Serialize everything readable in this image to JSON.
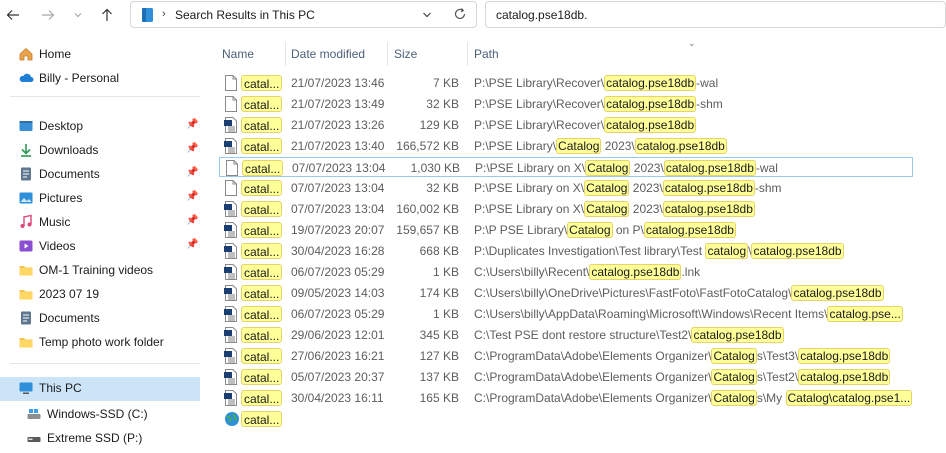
{
  "nav": {
    "back": "←",
    "forward": "→",
    "up": "↑"
  },
  "address": {
    "breadcrumb": "Search Results in This PC"
  },
  "search": {
    "value": "catalog.pse18db."
  },
  "sidebar": {
    "items": [
      {
        "label": "Home",
        "icon": "home-icon"
      },
      {
        "label": "Billy - Personal",
        "icon": "onedrive-icon"
      },
      {
        "label": "Desktop",
        "icon": "desktop-icon"
      },
      {
        "label": "Downloads",
        "icon": "downloads-icon"
      },
      {
        "label": "Documents",
        "icon": "documents-icon"
      },
      {
        "label": "Pictures",
        "icon": "pictures-icon"
      },
      {
        "label": "Music",
        "icon": "music-icon"
      },
      {
        "label": "Videos",
        "icon": "videos-icon"
      },
      {
        "label": "OM-1 Training videos",
        "icon": "folder-icon"
      },
      {
        "label": "2023 07 19",
        "icon": "folder-icon"
      },
      {
        "label": "Documents",
        "icon": "documents-icon"
      },
      {
        "label": "Temp photo work folder",
        "icon": "folder-icon"
      },
      {
        "label": "This PC",
        "icon": "this-pc-icon"
      },
      {
        "label": "Windows-SSD (C:)",
        "icon": "drive-icon"
      },
      {
        "label": "Extreme SSD (P:)",
        "icon": "drive-icon"
      }
    ]
  },
  "columns": {
    "name": "Name",
    "date": "Date modified",
    "size": "Size",
    "path": "Path"
  },
  "rows": [
    {
      "name": "catal...",
      "type": "generic",
      "date": "21/07/2023 13:46",
      "size": "7 KB",
      "path": [
        [
          "P:\\PSE Library\\Recover\\",
          0
        ],
        [
          "catalog.pse18db",
          1
        ],
        [
          "-wal",
          0
        ]
      ]
    },
    {
      "name": "catal...",
      "type": "generic",
      "date": "21/07/2023 13:49",
      "size": "32 KB",
      "path": [
        [
          "P:\\PSE Library\\Recover\\",
          0
        ],
        [
          "catalog.pse18db",
          1
        ],
        [
          "-shm",
          0
        ]
      ]
    },
    {
      "name": "catal...",
      "type": "db",
      "date": "21/07/2023 13:26",
      "size": "129 KB",
      "path": [
        [
          "P:\\PSE Library\\Recover\\",
          0
        ],
        [
          "catalog.pse18db",
          1
        ]
      ]
    },
    {
      "name": "catal...",
      "type": "db",
      "date": "21/07/2023 13:40",
      "size": "166,572 KB",
      "path": [
        [
          "P:\\PSE Library\\",
          0
        ],
        [
          "Catalog",
          1
        ],
        [
          " 2023\\",
          0
        ],
        [
          "catalog.pse18db",
          1
        ]
      ]
    },
    {
      "name": "catal...",
      "type": "generic",
      "date": "07/07/2023 13:04",
      "size": "1,030 KB",
      "path": [
        [
          "P:\\PSE Library on X\\",
          0
        ],
        [
          "Catalog",
          1
        ],
        [
          " 2023\\",
          0
        ],
        [
          "catalog.pse18db",
          1
        ],
        [
          "-wal",
          0
        ]
      ]
    },
    {
      "name": "catal...",
      "type": "generic",
      "date": "07/07/2023 13:04",
      "size": "32 KB",
      "path": [
        [
          "P:\\PSE Library on X\\",
          0
        ],
        [
          "Catalog",
          1
        ],
        [
          " 2023\\",
          0
        ],
        [
          "catalog.pse18db",
          1
        ],
        [
          "-shm",
          0
        ]
      ]
    },
    {
      "name": "catal...",
      "type": "db",
      "date": "07/07/2023 13:04",
      "size": "160,002 KB",
      "path": [
        [
          "P:\\PSE Library on X\\",
          0
        ],
        [
          "Catalog",
          1
        ],
        [
          " 2023\\",
          0
        ],
        [
          "catalog.pse18db",
          1
        ]
      ]
    },
    {
      "name": "catal...",
      "type": "db",
      "date": "19/07/2023 20:07",
      "size": "159,657 KB",
      "path": [
        [
          "P:\\P PSE Library\\",
          0
        ],
        [
          "Catalog",
          1
        ],
        [
          " on P\\",
          0
        ],
        [
          "catalog.pse18db",
          1
        ]
      ]
    },
    {
      "name": "catal...",
      "type": "db",
      "date": "30/04/2023 16:28",
      "size": "668 KB",
      "path": [
        [
          "P:\\Duplicates Investigation\\Test library\\Test ",
          0
        ],
        [
          "catalog",
          1
        ],
        [
          "\\",
          0
        ],
        [
          "catalog.pse18db",
          1
        ]
      ]
    },
    {
      "name": "catal...",
      "type": "db",
      "date": "06/07/2023 05:29",
      "size": "1 KB",
      "path": [
        [
          "C:\\Users\\billy\\Recent\\",
          0
        ],
        [
          "catalog.pse18db",
          1
        ],
        [
          ".lnk",
          0
        ]
      ]
    },
    {
      "name": "catal...",
      "type": "db",
      "date": "09/05/2023 14:03",
      "size": "174 KB",
      "path": [
        [
          "C:\\Users\\billy\\OneDrive\\Pictures\\FastFoto\\FastFotoCatalog\\",
          0
        ],
        [
          "catalog.pse18db",
          1
        ]
      ]
    },
    {
      "name": "catal...",
      "type": "db",
      "date": "06/07/2023 05:29",
      "size": "1 KB",
      "path": [
        [
          "C:\\Users\\billy\\AppData\\Roaming\\Microsoft\\Windows\\Recent Items\\",
          0
        ],
        [
          "catalog.pse...",
          1
        ]
      ]
    },
    {
      "name": "catal...",
      "type": "db",
      "date": "29/06/2023 12:01",
      "size": "345 KB",
      "path": [
        [
          "C:\\Test PSE dont restore structure\\Test2\\",
          0
        ],
        [
          "catalog.pse18db",
          1
        ]
      ]
    },
    {
      "name": "catal...",
      "type": "db",
      "date": "27/06/2023 16:21",
      "size": "127 KB",
      "path": [
        [
          "C:\\ProgramData\\Adobe\\Elements Organizer\\",
          0
        ],
        [
          "Catalog",
          1
        ],
        [
          "s\\Test3\\",
          0
        ],
        [
          "catalog.pse18db",
          1
        ]
      ]
    },
    {
      "name": "catal...",
      "type": "db",
      "date": "05/07/2023 20:37",
      "size": "137 KB",
      "path": [
        [
          "C:\\ProgramData\\Adobe\\Elements Organizer\\",
          0
        ],
        [
          "Catalog",
          1
        ],
        [
          "s\\Test2\\",
          0
        ],
        [
          "catalog.pse18db",
          1
        ]
      ]
    },
    {
      "name": "catal...",
      "type": "db",
      "date": "30/04/2023 16:11",
      "size": "165 KB",
      "path": [
        [
          "C:\\ProgramData\\Adobe\\Elements Organizer\\",
          0
        ],
        [
          "Catalog",
          1
        ],
        [
          "s\\My ",
          0
        ],
        [
          "Catalog\\catalog.pse1...",
          1
        ]
      ]
    },
    {
      "name": "catal...",
      "type": "web",
      "date": "",
      "size": "",
      "path": []
    }
  ],
  "colors": {
    "highlight": "#ffff99",
    "selected": "#cce4f7",
    "header_text": "#4c607a"
  }
}
